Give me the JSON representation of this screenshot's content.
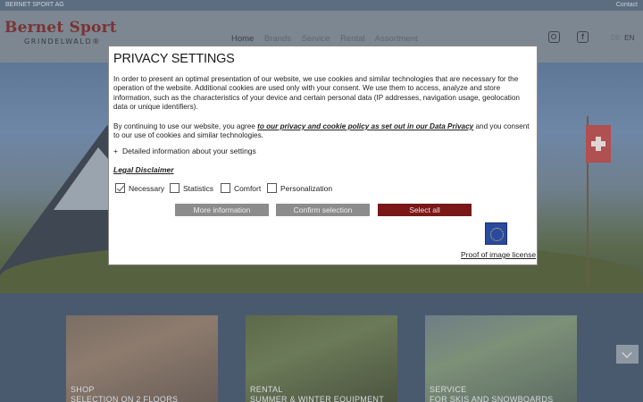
{
  "topbar": {
    "left": "BERNET SPORT AG",
    "right": "Contact"
  },
  "logo": {
    "name": "Bernet Sport",
    "location": "GRINDELWALD®"
  },
  "nav": {
    "items": [
      "Home",
      "Brands",
      "Service",
      "Rental",
      "Assortment"
    ]
  },
  "lang": {
    "de": "DE",
    "en": "EN"
  },
  "cards": [
    {
      "line1": "SHOP",
      "line2": "SELECTION ON 2 FLOORS"
    },
    {
      "line1": "RENTAL",
      "line2": "SUMMER & WINTER EQUIPMENT"
    },
    {
      "line1": "SERVICE",
      "line2": "FOR SKIS AND SNOWBOARDS"
    }
  ],
  "modal": {
    "title": "PRIVACY SETTINGS",
    "p1": "In order to present an optimal presentation of our website, we use cookies and similar technologies that are necessary for the operation of the website. Additional cookies are used only with your consent. We use them to access, analyze and store information, such as the characteristics of your device and certain personal data (IP addresses, navigation usage, geolocation data or unique identifiers).",
    "p2_before": "By continuing to use our website, you agree ",
    "p2_link": "to our privacy and cookie policy as set out in our Data Privacy",
    "p2_after": " and you consent to our use of cookies and similar technologies.",
    "details_plus": "+",
    "details": "Detailed information about your settings",
    "legal": "Legal Disclaimer",
    "checks": {
      "necessary": "Necessary",
      "statistics": "Statistics",
      "comfort": "Comfort",
      "personalization": "Personalization"
    },
    "buttons": {
      "more": "More information",
      "confirm": "Confirm selection",
      "all": "Select all"
    },
    "proof": "Proof of image license"
  }
}
